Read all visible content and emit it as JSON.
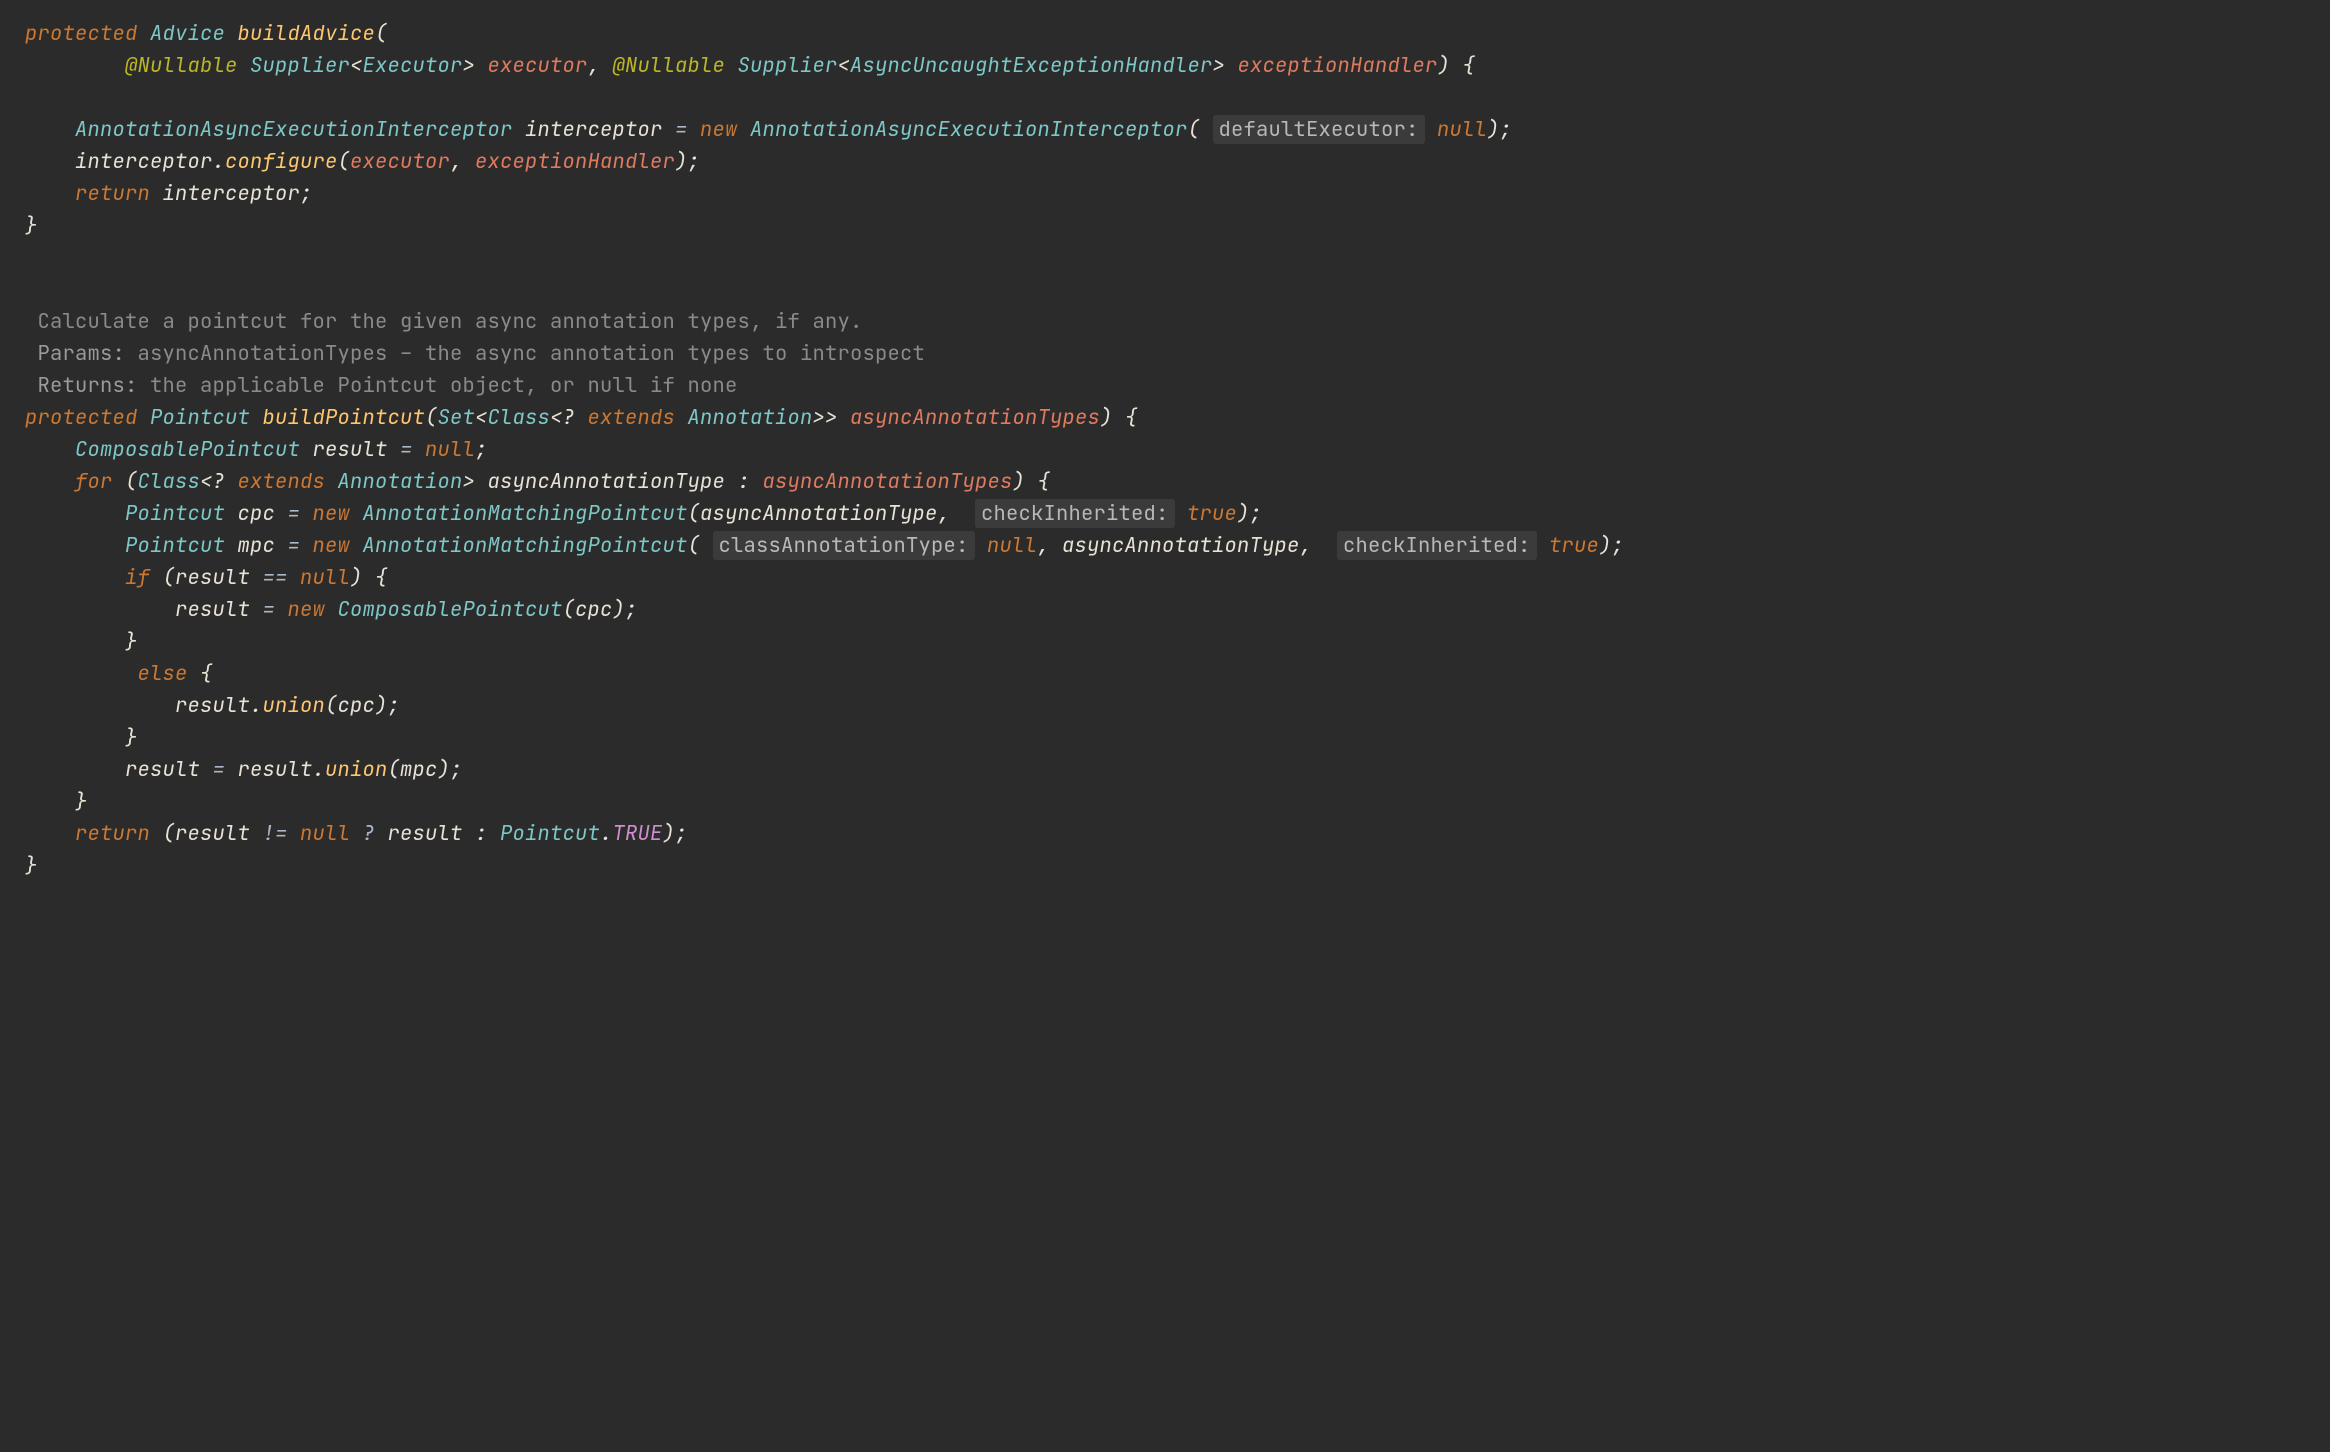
{
  "code": {
    "kw_protected": "protected",
    "kw_new": "new",
    "kw_for": "for",
    "kw_if": "if",
    "kw_else": "else",
    "kw_return": "return",
    "kw_extends": "extends",
    "kw_null": "null",
    "kw_true": "true",
    "type_Advice": "Advice",
    "type_Supplier": "Supplier",
    "type_Executor": "Executor",
    "type_AsyncUncaughtExceptionHandler": "AsyncUncaughtExceptionHandler",
    "type_AnnotationAsyncExecutionInterceptor": "AnnotationAsyncExecutionInterceptor",
    "type_Pointcut": "Pointcut",
    "type_Set": "Set",
    "type_Class": "Class",
    "type_Annotation": "Annotation",
    "type_ComposablePointcut": "ComposablePointcut",
    "type_AnnotationMatchingPointcut": "AnnotationMatchingPointcut",
    "ann_Nullable": "@Nullable",
    "mth_buildAdvice": "buildAdvice",
    "mth_buildPointcut": "buildPointcut",
    "call_configure": "configure",
    "call_union": "union",
    "field_TRUE": "TRUE",
    "p_executor": "executor",
    "p_exceptionHandler": "exceptionHandler",
    "p_asyncAnnotationTypes": "asyncAnnotationTypes",
    "v_interceptor": "interceptor",
    "v_result": "result",
    "v_asyncAnnotationType": "asyncAnnotationType",
    "v_cpc": "cpc",
    "v_mpc": "mpc",
    "hint_defaultExecutor": "defaultExecutor:",
    "hint_checkInherited": "checkInherited:",
    "hint_classAnnotationType": "classAnnotationType:",
    "doc_line1": "Calculate a pointcut for the given async annotation types, if any.",
    "doc_params_tag": "Params:",
    "doc_params_body": " asyncAnnotationTypes – the async annotation types to introspect",
    "doc_returns_tag": "Returns:",
    "doc_returns_body": " the applicable Pointcut object, or null if none"
  }
}
